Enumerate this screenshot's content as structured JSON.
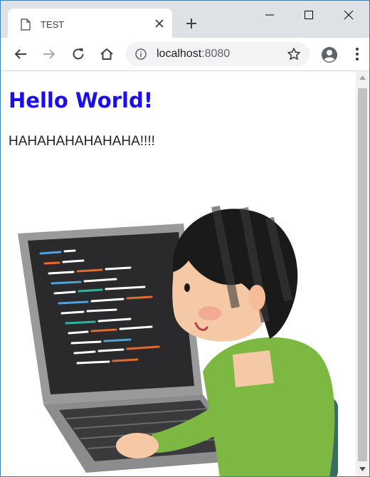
{
  "tab": {
    "title": "TEST"
  },
  "address": {
    "host": "localhost",
    "port": ":8080"
  },
  "page": {
    "heading": "Hello World!",
    "text": "HAHAHAHAHAHAHA!!!!"
  },
  "colors": {
    "heading": "#1a0dee",
    "titlebar": "#dee1e6",
    "omnibox": "#f1f3f4"
  },
  "icons": [
    "document-icon",
    "close-icon",
    "new-tab-icon",
    "minimize-icon",
    "maximize-icon",
    "window-close-icon",
    "back-icon",
    "forward-icon",
    "reload-icon",
    "home-icon",
    "info-icon",
    "star-icon",
    "profile-icon",
    "menu-icon"
  ]
}
